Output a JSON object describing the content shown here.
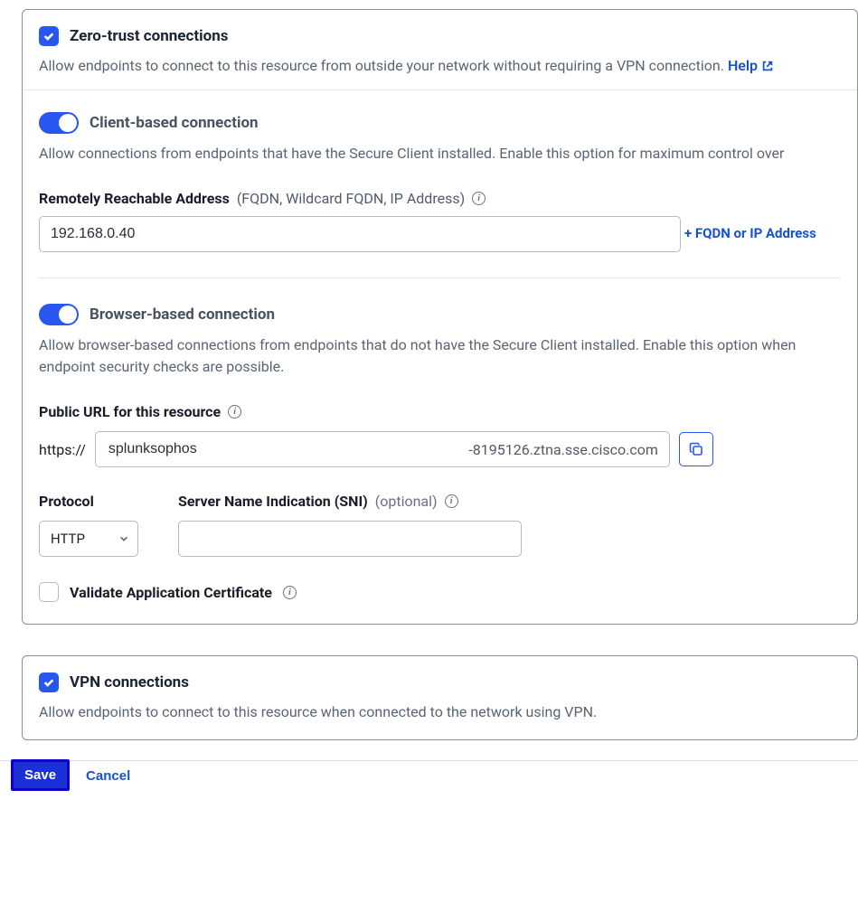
{
  "zeroTrust": {
    "title": "Zero-trust connections",
    "desc": "Allow endpoints to connect to this resource from outside your network without requiring a VPN connection. ",
    "help": "Help"
  },
  "clientBased": {
    "title": "Client-based connection",
    "desc": "Allow connections from endpoints that have the Secure Client installed. Enable this option for maximum control over",
    "addressLabel": "Remotely Reachable Address",
    "addressHint": "(FQDN, Wildcard FQDN, IP Address)",
    "addressValue": "192.168.0.40",
    "addLink": "+ FQDN or IP Address"
  },
  "browserBased": {
    "title": "Browser-based connection",
    "desc": "Allow browser-based connections from endpoints that do not have the Secure Client installed. Enable this option when endpoint security checks are possible.",
    "publicUrlLabel": "Public URL for this resource",
    "httpsPrefix": "https://",
    "urlValue": "splunksophos",
    "urlSuffix": "-8195126.ztna.sse.cisco.com",
    "protocolLabel": "Protocol",
    "protocolValue": "HTTP",
    "sniLabel": "Server Name Indication (SNI)",
    "sniHint": "(optional)",
    "sniValue": "",
    "validateLabel": "Validate Application Certificate"
  },
  "vpn": {
    "title": "VPN connections",
    "desc": "Allow endpoints to connect to this resource when connected to the network using VPN."
  },
  "footer": {
    "save": "Save",
    "cancel": "Cancel"
  }
}
